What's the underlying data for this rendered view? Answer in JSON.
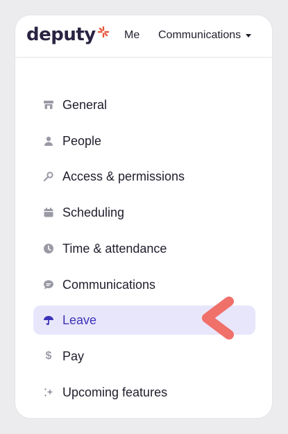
{
  "brand": {
    "logo_text": "deputy",
    "accent": "#e8583d"
  },
  "header": {
    "nav": [
      {
        "label": "Me"
      },
      {
        "label": "Communications",
        "icon": "caret-down-icon"
      }
    ]
  },
  "sidebar": {
    "active_color": "#3d33b8",
    "active_bg": "#e8e6fb",
    "items": [
      {
        "label": "General",
        "icon": "store-icon"
      },
      {
        "label": "People",
        "icon": "person-icon"
      },
      {
        "label": "Access & permissions",
        "icon": "key-icon"
      },
      {
        "label": "Scheduling",
        "icon": "calendar-icon"
      },
      {
        "label": "Time & attendance",
        "icon": "clock-icon"
      },
      {
        "label": "Communications",
        "icon": "chat-icon"
      },
      {
        "label": "Leave",
        "icon": "umbrella-icon",
        "active": true
      },
      {
        "label": "Pay",
        "icon": "dollar-icon"
      },
      {
        "label": "Upcoming features",
        "icon": "sparkle-icon"
      }
    ]
  },
  "annotation": {
    "icon": "chevron-left-pointer-icon",
    "color": "#f0706a"
  }
}
